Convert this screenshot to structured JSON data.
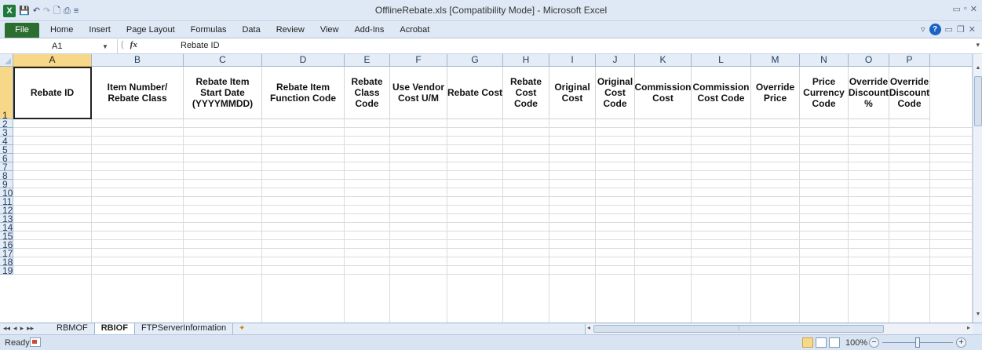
{
  "window": {
    "title": "OfflineRebate.xls  [Compatibility Mode]  -  Microsoft Excel",
    "controls": [
      "▭",
      "▫",
      "✕"
    ]
  },
  "qat": {
    "logo": "X",
    "save": "💾",
    "undo": "↶",
    "redo": "↷",
    "print_preview": "🗋",
    "print": "⎙",
    "customize": "≡"
  },
  "ribbon": {
    "tabs": [
      "File",
      "Home",
      "Insert",
      "Page Layout",
      "Formulas",
      "Data",
      "Review",
      "View",
      "Add-Ins",
      "Acrobat"
    ],
    "right": {
      "minimize_ribbon": "▿",
      "help": "?",
      "minimize": "▭",
      "restore": "❐",
      "close": "✕"
    }
  },
  "formula_bar": {
    "name_box": "A1",
    "fx": "fx",
    "value": "Rebate ID"
  },
  "sheet": {
    "columns": [
      {
        "letter": "A",
        "header": "Rebate ID"
      },
      {
        "letter": "B",
        "header": "Item Number/\nRebate Class"
      },
      {
        "letter": "C",
        "header": "Rebate Item\nStart Date\n(YYYYMMDD)"
      },
      {
        "letter": "D",
        "header": "Rebate Item\nFunction Code"
      },
      {
        "letter": "E",
        "header": "Rebate\nClass\nCode"
      },
      {
        "letter": "F",
        "header": "Use Vendor\nCost U/M"
      },
      {
        "letter": "G",
        "header": "Rebate Cost"
      },
      {
        "letter": "H",
        "header": "Rebate\nCost\nCode"
      },
      {
        "letter": "I",
        "header": "Original\nCost"
      },
      {
        "letter": "J",
        "header": "Original\nCost\nCode"
      },
      {
        "letter": "K",
        "header": "Commission\nCost"
      },
      {
        "letter": "L",
        "header": "Commission\nCost Code"
      },
      {
        "letter": "M",
        "header": "Override\nPrice"
      },
      {
        "letter": "N",
        "header": "Price\nCurrency\nCode"
      },
      {
        "letter": "O",
        "header": "Override\nDiscount\n%"
      },
      {
        "letter": "P",
        "header": "Override\nDiscount\nCode"
      }
    ],
    "rows": [
      "1",
      "2",
      "3",
      "4",
      "5",
      "6",
      "7",
      "8",
      "9",
      "10",
      "11",
      "12",
      "13",
      "14",
      "15",
      "16",
      "17",
      "18",
      "19"
    ],
    "selected_cell": "A1"
  },
  "sheet_tabs": {
    "nav": [
      "◂◂",
      "◂",
      "▸",
      "▸▸"
    ],
    "tabs": [
      "RBMOF",
      "RBIOF",
      "FTPServerInformation"
    ],
    "active": "RBIOF",
    "new_sheet": "✦"
  },
  "status": {
    "ready": "Ready",
    "zoom": "100%",
    "zoom_out": "−",
    "zoom_in": "+"
  },
  "colors": {
    "accent": "#2c6e2f",
    "header_bg": "#e4ecf7",
    "selected_header": "#f7d889"
  }
}
